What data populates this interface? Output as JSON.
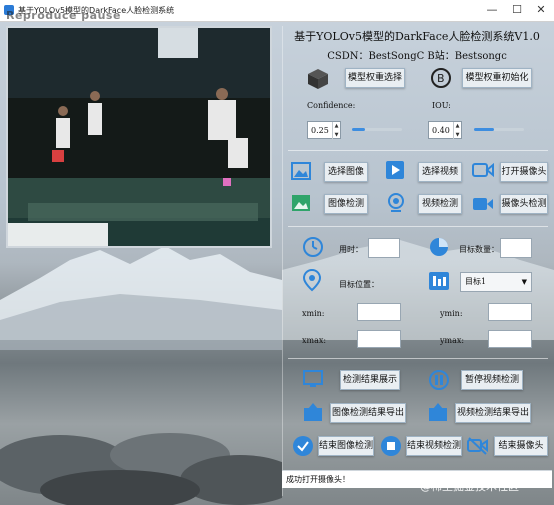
{
  "window": {
    "title": "基于YOLOv5模型的DarkFace人脸检测系统",
    "minimize": "—",
    "maximize": "☐",
    "close": "✕",
    "overlay_watermark": "Reproduce pause"
  },
  "header": {
    "title": "基于YOLOv5模型的DarkFace人脸检测系统V1.0",
    "subtitle": "CSDN：BestSongC   B站：Bestsongc"
  },
  "model": {
    "select_label": "模型权重选择",
    "init_label": "模型权重初始化",
    "icon": "cube-icon",
    "init_icon": "b-icon"
  },
  "params": {
    "confidence_label": "Confidence:",
    "confidence_value": "0.25",
    "confidence_fraction": 0.25,
    "iou_label": "IOU:",
    "iou_value": "0.40",
    "iou_fraction": 0.4
  },
  "input_buttons": {
    "select_image": "选择图像",
    "select_video": "选择视频",
    "open_camera": "打开摄像头",
    "image_detect": "图像检测",
    "video_detect": "视频检测",
    "camera_detect": "摄像头检测"
  },
  "results": {
    "time_label": "用时：",
    "target_count_label": "目标数量：",
    "target_position_label": "目标位置：",
    "target_select_value": "目标1",
    "xmin_label": "xmin:",
    "ymin_label": "ymin:",
    "xmax_label": "xmax:",
    "ymax_label": "ymax:"
  },
  "action_buttons": {
    "show_results": "检测结果展示",
    "pause_video": "暂停视频检测",
    "export_image": "图像检测结果导出",
    "export_video": "视频检测结果导出",
    "stop_image": "结束图像检测",
    "stop_video": "结束视频检测",
    "stop_camera": "结束摄像头"
  },
  "status": {
    "message": "成功打开摄像头！"
  },
  "footer_watermark": "@稀土掘金技术社区",
  "colors": {
    "accent": "#3d8de0",
    "icon_blue": "#2f86d9",
    "button_bg": "#e9eef2"
  }
}
